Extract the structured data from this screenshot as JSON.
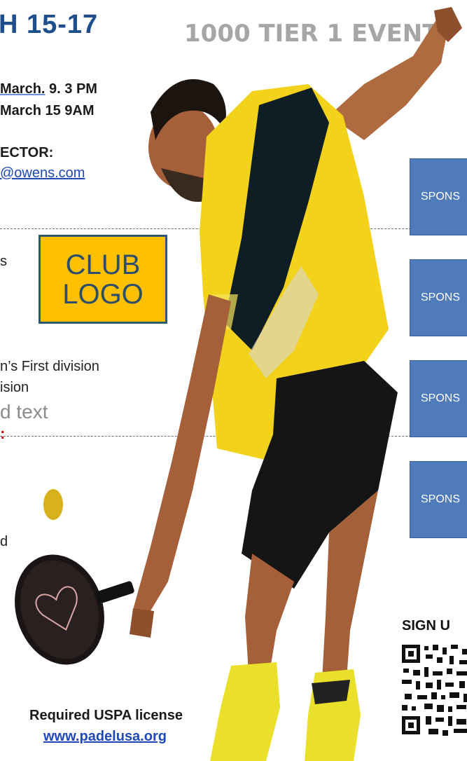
{
  "header": {
    "title": "H 15-17",
    "tier_text": "1000 TIER 1 EVENT"
  },
  "schedule": {
    "line1_a": "March.",
    "line1_b": " 9. 3 PM",
    "line2": "March 15 9AM"
  },
  "director": {
    "label": "ECTOR:",
    "email": "@owens.com"
  },
  "fragments": {
    "s": "s",
    "d": "d",
    "red": ":"
  },
  "divisions": {
    "line1": "n’s First division",
    "line2": "ision"
  },
  "placeholder_text": "d text",
  "club_logo": {
    "line1": "CLUB",
    "line2": "LOGO",
    "bg_color": "#ffc000"
  },
  "sponsors": [
    {
      "label": "SPONS"
    },
    {
      "label": "SPONS"
    },
    {
      "label": "SPONS"
    },
    {
      "label": "SPONS"
    }
  ],
  "signup": {
    "label": "SIGN U"
  },
  "footer": {
    "license": "Required USPA license",
    "link": "www.padelusa.org"
  },
  "colors": {
    "title": "#1f4e8c",
    "sponsor_box": "#4f7bbd",
    "shirt": "#f2d21a",
    "link": "#1f49b6"
  }
}
